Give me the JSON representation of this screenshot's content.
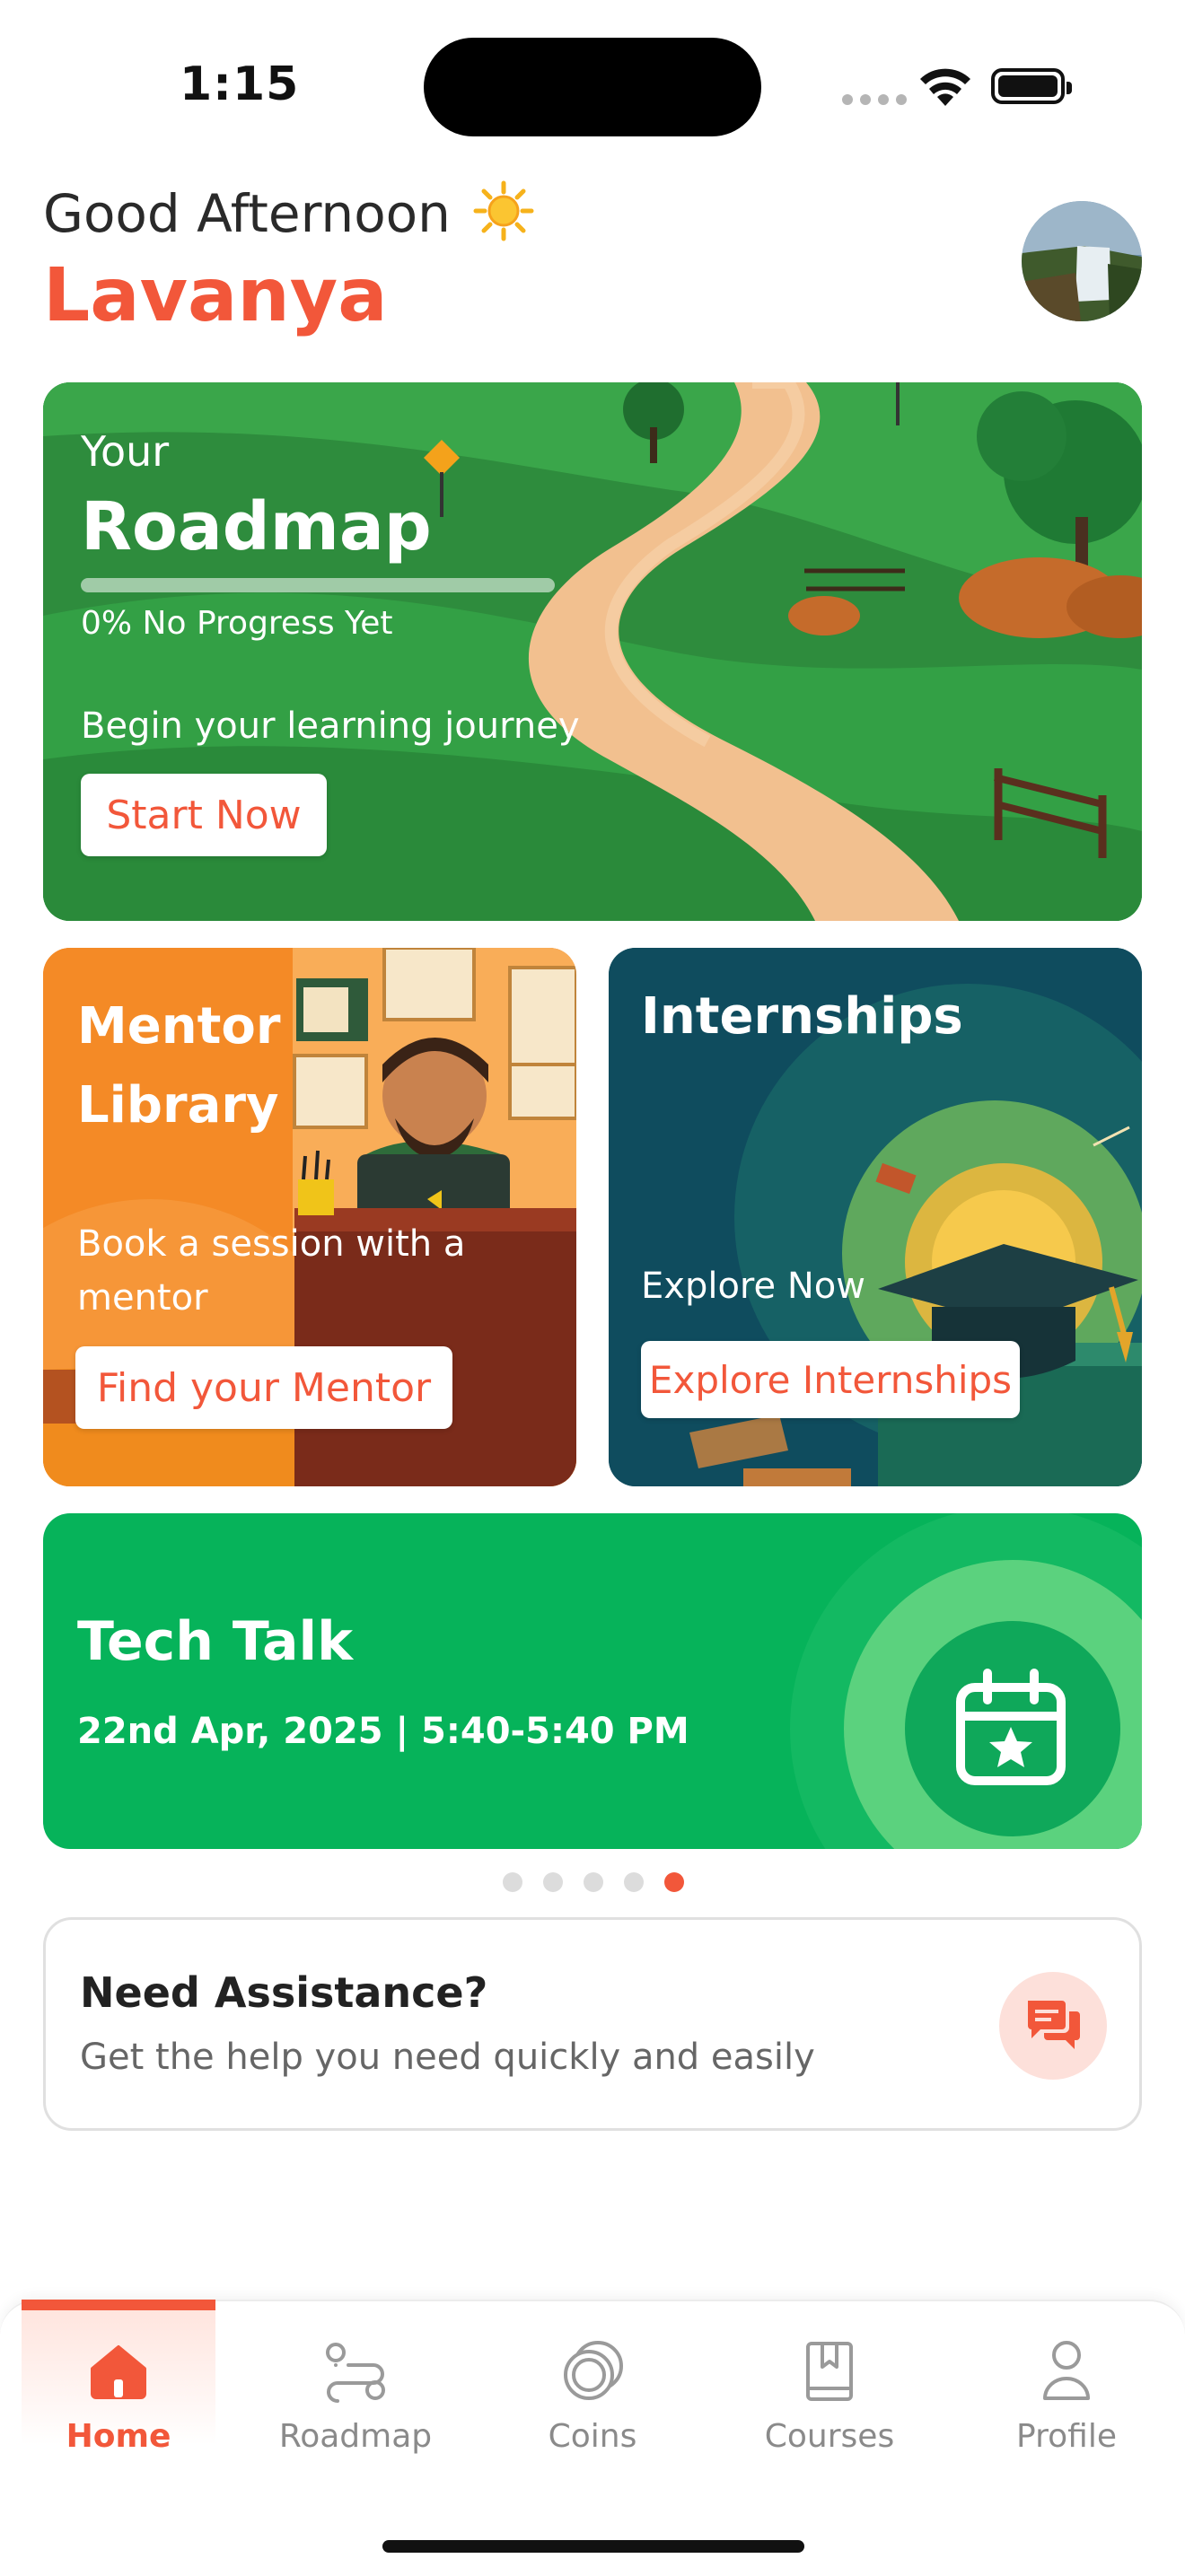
{
  "status_bar": {
    "time": "1:15"
  },
  "greeting": {
    "text": "Good Afternoon",
    "name": "Lavanya"
  },
  "roadmap": {
    "label": "Your",
    "title": "Roadmap",
    "progress": 0,
    "progress_text": "0% No Progress Yet",
    "subtitle": "Begin your learning journey",
    "button": "Start Now"
  },
  "mentor": {
    "title_line1": "Mentor",
    "title_line2": "Library",
    "desc_line1": "Book a session with a",
    "desc_line2": "mentor",
    "button": "Find your Mentor"
  },
  "internships": {
    "title": "Internships",
    "desc": "Explore Now",
    "button": "Explore Internships"
  },
  "tech_talk": {
    "title": "Tech Talk",
    "datetime": "22nd Apr, 2025 | 5:40-5:40 PM"
  },
  "carousel": {
    "count": 5,
    "active_index": 4
  },
  "assistance": {
    "title": "Need Assistance?",
    "subtitle": "Get the help you need quickly and easily"
  },
  "nav": [
    {
      "label": "Home",
      "icon": "home-icon",
      "active": true
    },
    {
      "label": "Roadmap",
      "icon": "route-icon",
      "active": false
    },
    {
      "label": "Coins",
      "icon": "coins-icon",
      "active": false
    },
    {
      "label": "Courses",
      "icon": "book-icon",
      "active": false
    },
    {
      "label": "Profile",
      "icon": "user-icon",
      "active": false
    }
  ],
  "colors": {
    "accent": "#f2573a",
    "tech_green": "#06b35a",
    "mentor_orange": "#f48a26",
    "intern_teal": "#0f4c5e"
  }
}
